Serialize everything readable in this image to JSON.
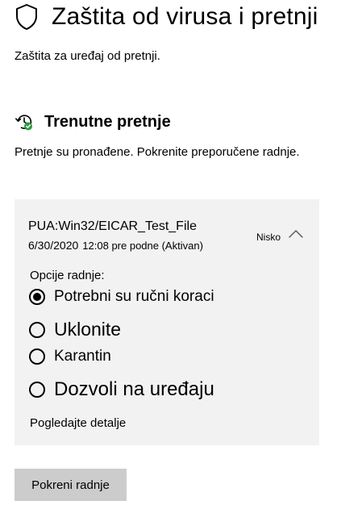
{
  "header": {
    "title": "Zaštita od virusa i pretnji",
    "icon": "shield-icon"
  },
  "subtitle": "Zaštita za uređaj od pretnji.",
  "current_threats": {
    "title": "Trenutne pretnje",
    "icon": "threat-history-icon",
    "description": "Pretnje su pronađene. Pokrenite preporučene radnje."
  },
  "threat": {
    "name": "PUA:Win32/EICAR_Test_File",
    "date": "6/30/2020",
    "time_status": "12:08 pre podne (Aktivan)",
    "severity": "Nisko",
    "options_label": "Opcije radnje:",
    "options": [
      {
        "label": "Potrebni su ručni koraci",
        "selected": true
      },
      {
        "label": "Uklonite",
        "selected": false
      },
      {
        "label": "Karantin",
        "selected": false
      },
      {
        "label": "Dozvoli na uređaju",
        "selected": false
      }
    ],
    "details_link": "Pogledajte detalje"
  },
  "action_button": "Pokreni radnje",
  "colors": {
    "background": "#ffffff",
    "card_background": "#f2f2f2",
    "button_background": "#cccccc",
    "status_green": "#2e9e3e"
  }
}
